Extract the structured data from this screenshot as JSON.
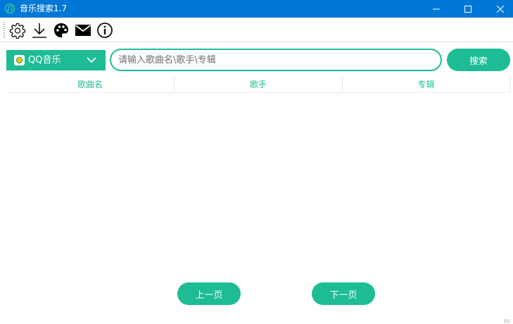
{
  "window": {
    "title": "音乐搜索1.7"
  },
  "toolbar": {
    "tools": [
      {
        "name": "settings",
        "icon": "gear-icon"
      },
      {
        "name": "download",
        "icon": "download-icon"
      },
      {
        "name": "theme",
        "icon": "palette-icon"
      },
      {
        "name": "feedback",
        "icon": "mail-icon"
      },
      {
        "name": "about",
        "icon": "info-icon"
      }
    ]
  },
  "search": {
    "source": "QQ音乐",
    "source_icon": "qq-music-icon",
    "placeholder": "请输入歌曲名\\歌手\\专辑",
    "value": "",
    "button_label": "搜索"
  },
  "table": {
    "columns": [
      "歌曲名",
      "歌手",
      "专辑"
    ],
    "rows": []
  },
  "pagination": {
    "prev_label": "上一页",
    "next_label": "下一页"
  },
  "colors": {
    "accent": "#1dbc95",
    "titlebar": "#0078d7"
  }
}
